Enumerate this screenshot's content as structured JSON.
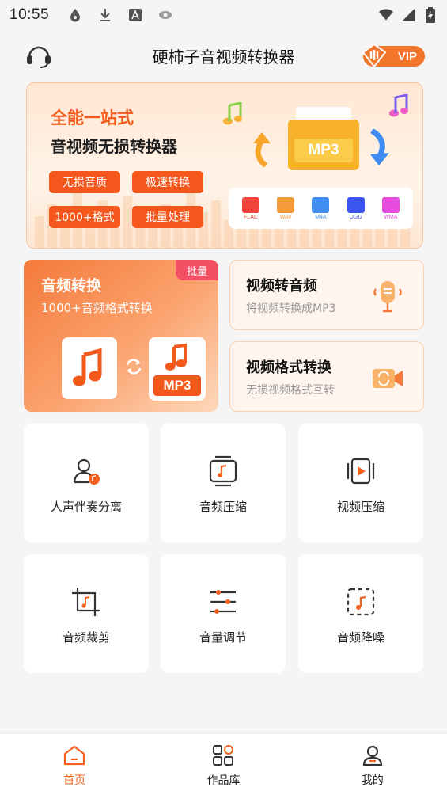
{
  "status_bar": {
    "time": "10:55",
    "icons": [
      "ink-drop-icon",
      "download-icon",
      "font-a-icon",
      "eye-icon",
      "wifi-icon",
      "signal-icon",
      "battery-icon"
    ]
  },
  "header": {
    "title": "硬柿子音视频转换器",
    "vip_label": "VIP",
    "support_icon": "headset-icon"
  },
  "banner": {
    "headline": "全能一站式",
    "subheadline": "音视频无损转换器",
    "tags": [
      "无损音质",
      "极速转换",
      "1000+格式",
      "批量处理"
    ],
    "center_label": "MP3",
    "formats": [
      {
        "label": "FLAC",
        "color": "#f0453a"
      },
      {
        "label": "WAV",
        "color": "#f39a3a"
      },
      {
        "label": "M4A",
        "color": "#3f8ef0"
      },
      {
        "label": "OGG",
        "color": "#3d55f0"
      },
      {
        "label": "WMA",
        "color": "#e64be0"
      }
    ]
  },
  "cards": {
    "audio_convert": {
      "title": "音频转换",
      "subtitle": "1000+音频格式转换",
      "badge": "批量",
      "mp3_label": "MP3"
    },
    "video_to_audio": {
      "title": "视频转音频",
      "subtitle": "将视频转换成MP3"
    },
    "video_format": {
      "title": "视频格式转换",
      "subtitle": "无损视频格式互转"
    }
  },
  "tools": [
    {
      "label": "人声伴奏分离",
      "icon": "vocal-separation-icon"
    },
    {
      "label": "音频压缩",
      "icon": "audio-compress-icon"
    },
    {
      "label": "视频压缩",
      "icon": "video-compress-icon"
    },
    {
      "label": "音频裁剪",
      "icon": "audio-crop-icon"
    },
    {
      "label": "音量调节",
      "icon": "volume-adjust-icon"
    },
    {
      "label": "音频降噪",
      "icon": "noise-reduction-icon"
    }
  ],
  "bottom_nav": [
    {
      "label": "首页",
      "icon": "home-icon",
      "active": true
    },
    {
      "label": "作品库",
      "icon": "grid-icon",
      "active": false
    },
    {
      "label": "我的",
      "icon": "user-icon",
      "active": false
    }
  ],
  "colors": {
    "accent": "#f4611f",
    "tag": "#f4561b",
    "badge": "#f25164"
  }
}
